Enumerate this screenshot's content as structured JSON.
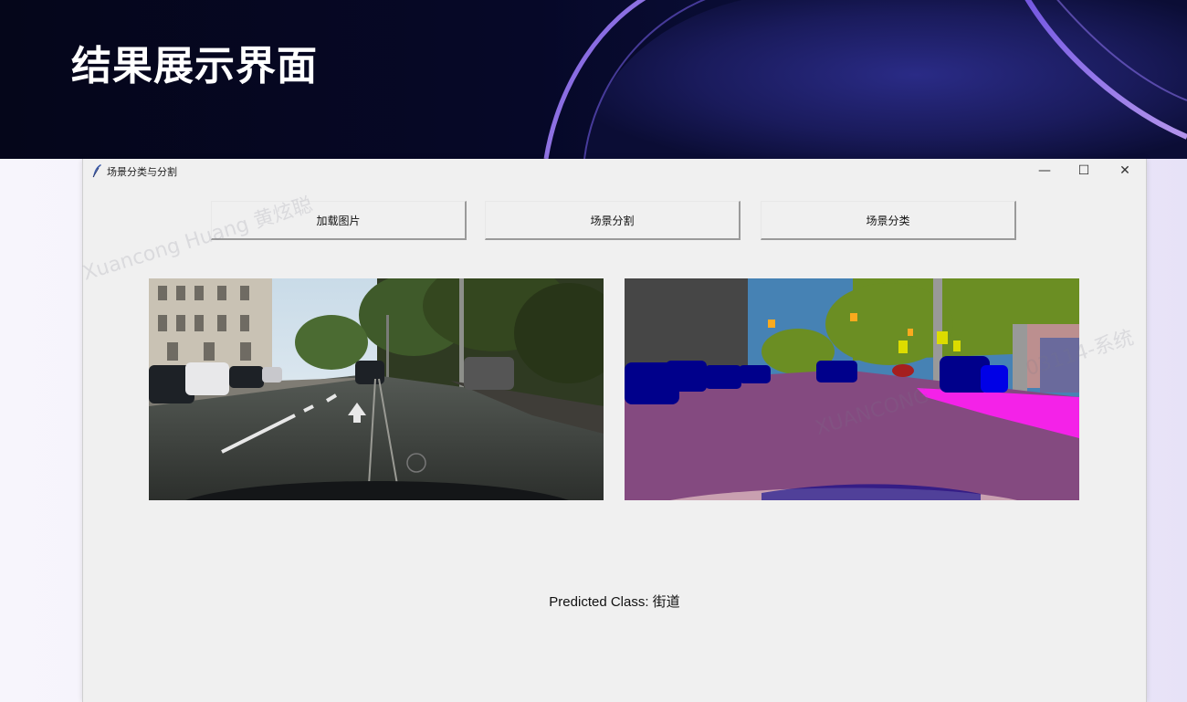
{
  "slide": {
    "title": "结果展示界面"
  },
  "window": {
    "title": "场景分类与分割",
    "controls": {
      "minimize": "—",
      "maximize": "☐",
      "close": "✕"
    }
  },
  "toolbar": {
    "load_image_label": "加载图片",
    "segment_label": "场景分割",
    "classify_label": "场景分类"
  },
  "result": {
    "text": "Predicted Class: 街道"
  },
  "watermarks": {
    "a": "Xuancong Huang 黄炫聪",
    "b": "XUANCONG",
    "c": "03114-系统"
  },
  "colors": {
    "road": "#844a80",
    "car": "#00008b",
    "vegetation": "#6b8e23",
    "sky": "#4682b4",
    "building": "#464646",
    "sidewalk": "#f422e8",
    "pole": "#999999",
    "traffic_sign": "#dcdc00",
    "traffic_light": "#faaa1e"
  },
  "icons": {
    "app": "feather-icon",
    "minimize": "minimize-icon",
    "maximize": "maximize-icon",
    "close": "close-icon"
  }
}
